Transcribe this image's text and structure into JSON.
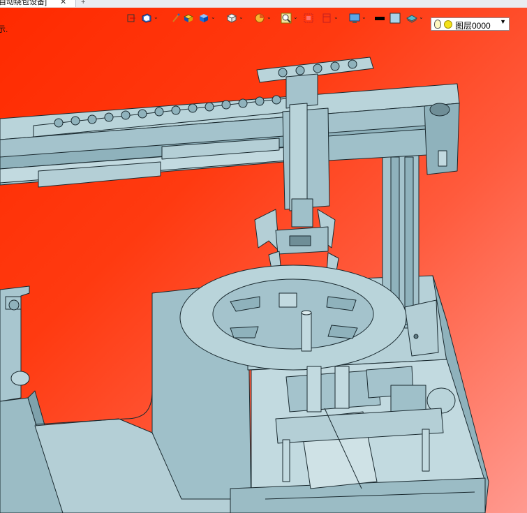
{
  "document_tab": {
    "title": "自动绕包设备]",
    "close_glyph": "✕",
    "new_tab_glyph": "+"
  },
  "viewport": {
    "hint_text": "示."
  },
  "toolbar": {
    "items": [
      {
        "icon": "section-view-icon",
        "has_dropdown": false
      },
      {
        "icon": "view-orientation-icon",
        "has_dropdown": true
      },
      {
        "icon": "pen-icon",
        "has_dropdown": false
      },
      {
        "icon": "shaded-box-icon",
        "has_dropdown": false
      },
      {
        "icon": "blue-cube-icon",
        "has_dropdown": true
      },
      {
        "icon": "white-cube-icon",
        "has_dropdown": true
      },
      {
        "icon": "display-style-icon",
        "has_dropdown": true
      },
      {
        "icon": "zoom-icon",
        "has_dropdown": true
      },
      {
        "icon": "render-icon",
        "has_dropdown": false
      },
      {
        "icon": "frame-icon",
        "has_dropdown": true
      },
      {
        "icon": "monitor-icon",
        "has_dropdown": true
      },
      {
        "icon": "color-black-icon",
        "has_dropdown": false
      },
      {
        "icon": "color-lightblue-icon",
        "has_dropdown": false
      },
      {
        "icon": "layer-stack-icon",
        "has_dropdown": true
      }
    ],
    "layer": {
      "name": "图层0000",
      "arrow": "▼"
    }
  },
  "colors": {
    "metal": "#a8c6cf",
    "metal_dark": "#7fa2ac",
    "edge": "#1a2a30",
    "bg_top": "#ff2a00",
    "bg_bottom": "#ff9a90"
  }
}
